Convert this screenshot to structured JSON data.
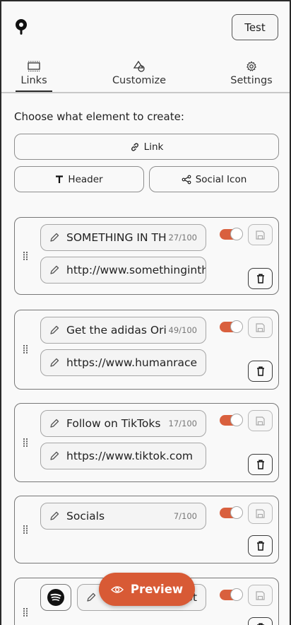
{
  "header": {
    "test_label": "Test"
  },
  "tabs": [
    {
      "label": "Links",
      "icon": "links-tab-icon",
      "active": true
    },
    {
      "label": "Customize",
      "icon": "shapes-icon"
    },
    {
      "label": "Settings",
      "icon": "gear-icon"
    }
  ],
  "create": {
    "prompt": "Choose what element to create:",
    "link_label": "Link",
    "header_label": "Header",
    "social_label": "Social Icon"
  },
  "cards": [
    {
      "title": "SOMETHING IN THE",
      "count": "27/100",
      "url": "http://www.somethinginthe",
      "enabled": true
    },
    {
      "title": "Get the adidas Ori",
      "count": "49/100",
      "url": "https://www.humanrace",
      "enabled": true
    },
    {
      "title": "Follow on TikToks",
      "count": "17/100",
      "url": "https://www.tiktok.com",
      "enabled": true
    },
    {
      "title": "Socials",
      "count": "7/100",
      "enabled": true
    }
  ],
  "social_card": {
    "icon": "spotify-icon",
    "value": "ot",
    "enabled": true
  },
  "preview": {
    "label": "Preview"
  },
  "colors": {
    "accent": "#d85a35",
    "toggle_on": "#d9603e",
    "border": "#777777"
  }
}
